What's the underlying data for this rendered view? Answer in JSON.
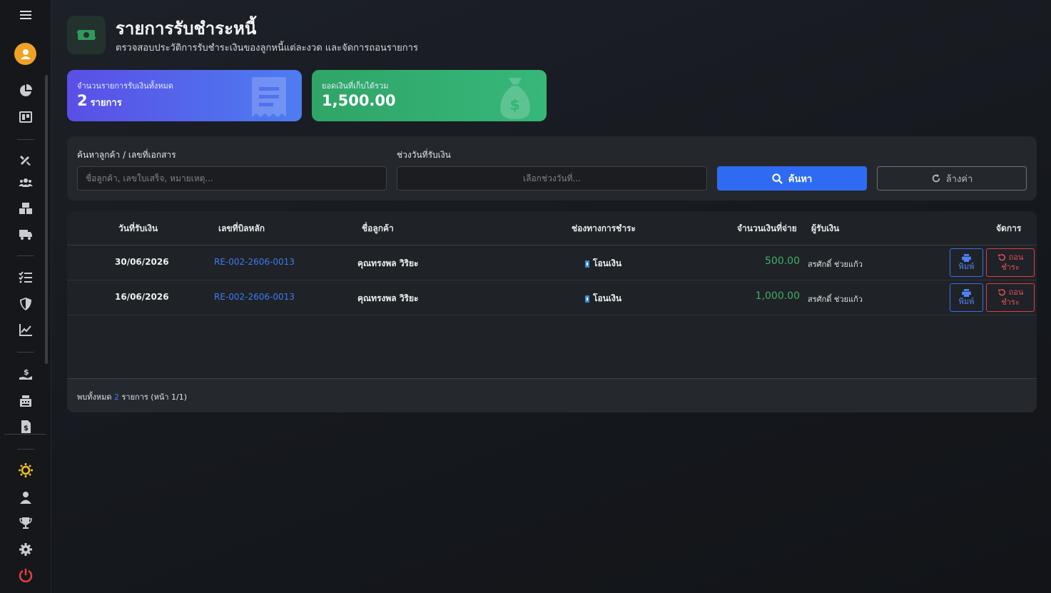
{
  "header": {
    "title": "รายการรับชำระหนี้",
    "subtitle": "ตรวจสอบประวัติการรับชำระเงินของลูกหนี้แต่ละงวด และจัดการถอนรายการ"
  },
  "stats": {
    "count_label": "จำนวนรายการรับเงินทั้งหมด",
    "count_value": "2",
    "count_unit": "รายการ",
    "total_label": "ยอดเงินที่เก็บได้รวม",
    "total_value": "1,500.00"
  },
  "filter": {
    "search_label": "ค้นหาลูกค้า / เลขที่เอกสาร",
    "search_placeholder": "ชื่อลูกค้า, เลขใบเสร็จ, หมายเหตุ...",
    "date_label": "ช่วงวันที่รับเงิน",
    "date_placeholder": "เลือกช่วงวันที่...",
    "search_button": "ค้นหา",
    "clear_button": "ล้างค่า"
  },
  "table": {
    "columns": {
      "date": "วันที่รับเงิน",
      "bill": "เลขที่บิลหลัก",
      "customer": "ชื่อลูกค้า",
      "channel": "ช่องทางการชำระ",
      "amount": "จำนวนเงินที่จ่าย",
      "receiver": "ผู้รับเงิน",
      "actions": "จัดการ"
    },
    "rows": [
      {
        "date": "30/06/2026",
        "bill": "RE-002-2606-0013",
        "customer": "คุณทรงพล วิริยะ",
        "channel": "โอนเงิน",
        "amount": "500.00",
        "receiver": "สรศักดิ์ ช่วยแก้ว",
        "print": "พิมพ์",
        "revert_top": "ถอน",
        "revert_bottom": "ชำระ"
      },
      {
        "date": "16/06/2026",
        "bill": "RE-002-2606-0013",
        "customer": "คุณทรงพล วิริยะ",
        "channel": "โอนเงิน",
        "amount": "1,000.00",
        "receiver": "สรศักดิ์ ช่วยแก้ว",
        "print": "พิมพ์",
        "revert_top": "ถอน",
        "revert_bottom": "ชำระ"
      }
    ],
    "footer": {
      "prefix": "พบทั้งหมด",
      "count": "2",
      "suffix": "รายการ (หน้า 1/1)"
    }
  },
  "colors": {
    "accent": "#2f6bf2",
    "success": "#3fb06c",
    "danger": "#e2505a",
    "avatar": "#f0a224",
    "settings_active": "#f3c425",
    "logout": "#e2403f"
  }
}
